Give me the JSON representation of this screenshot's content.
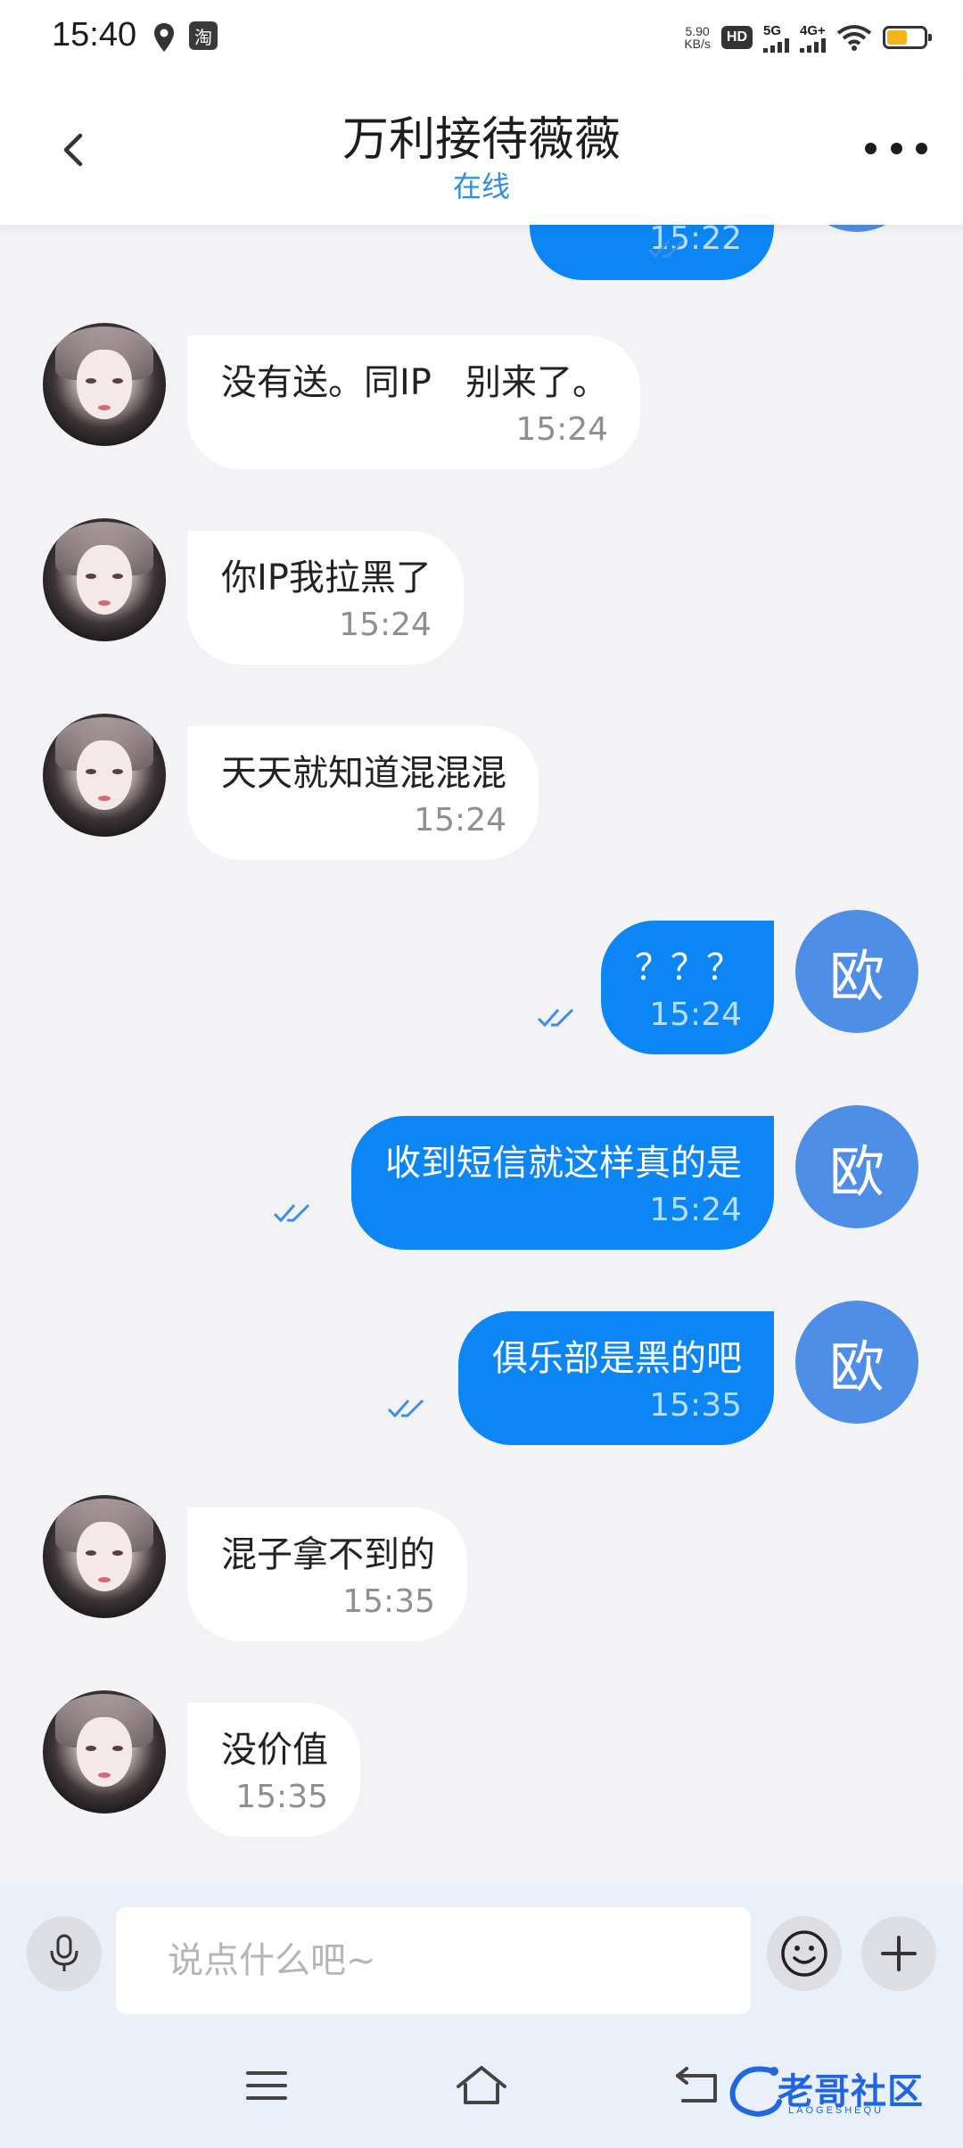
{
  "status_bar": {
    "time": "15:40",
    "app_badge": "淘",
    "net_speed_value": "5.90",
    "net_speed_unit": "KB/s",
    "hd_label": "HD",
    "sim1_label": "5G",
    "sim2_label": "4G+",
    "battery_level": 0.6,
    "battery_color": "#f5b41a"
  },
  "header": {
    "title": "万利接待薇薇",
    "status": "在线",
    "status_color": "#2d8de6"
  },
  "messages": [
    {
      "direction": "out",
      "text": "",
      "time": "15:22",
      "read": true,
      "avatar": "欧"
    },
    {
      "direction": "in",
      "text": "没有送。同IP   别来了。",
      "time": "15:24"
    },
    {
      "direction": "in",
      "text": "你IP我拉黑了",
      "time": "15:24"
    },
    {
      "direction": "in",
      "text": "天天就知道混混混",
      "time": "15:24"
    },
    {
      "direction": "out",
      "text": "？？？",
      "time": "15:24",
      "read": true,
      "avatar": "欧"
    },
    {
      "direction": "out",
      "text": "收到短信就这样真的是",
      "time": "15:24",
      "read": true,
      "avatar": "欧"
    },
    {
      "direction": "out",
      "text": "俱乐部是黑的吧",
      "time": "15:35",
      "read": true,
      "avatar": "欧"
    },
    {
      "direction": "in",
      "text": "混子拿不到的",
      "time": "15:35"
    },
    {
      "direction": "in",
      "text": "没价值",
      "time": "15:35"
    }
  ],
  "input_bar": {
    "placeholder": "说点什么吧~"
  },
  "colors": {
    "outgoing_bubble": "#0c86f5",
    "incoming_bubble": "#ffffff",
    "my_avatar": "#4f8ee6",
    "background": "#f3f3f5"
  },
  "watermark": {
    "text": "老哥社区",
    "subtext": "LAOGESHEQU"
  }
}
